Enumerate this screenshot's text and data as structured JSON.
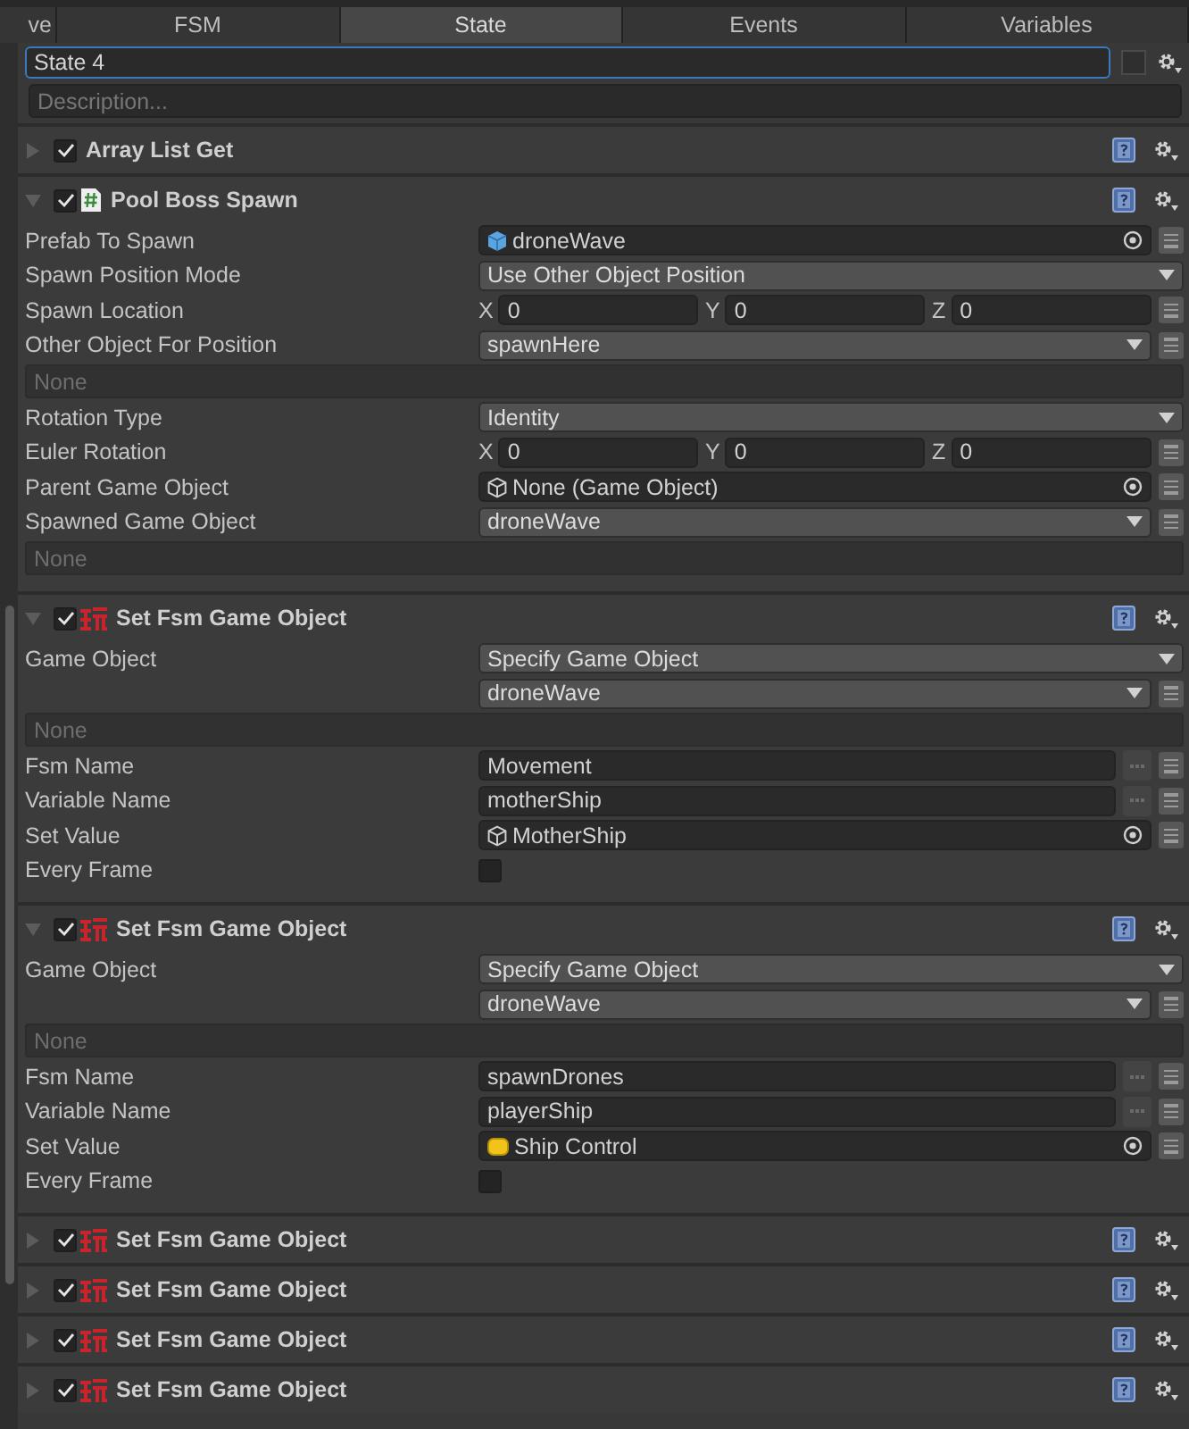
{
  "tabs": [
    {
      "label": "ve",
      "selected": false
    },
    {
      "label": "FSM",
      "selected": false
    },
    {
      "label": "State",
      "selected": true
    },
    {
      "label": "Events",
      "selected": false
    },
    {
      "label": "Variables",
      "selected": false
    }
  ],
  "state": {
    "name": "State 4",
    "description": {
      "placeholder": "Description..."
    }
  },
  "actions": [
    {
      "title": "Array List Get",
      "checked": true,
      "expanded": false,
      "kind": "plain"
    },
    {
      "title": "Pool Boss Spawn",
      "checked": true,
      "expanded": true,
      "kind": "script",
      "fields": [
        {
          "kind": "prefab_object",
          "label": "Prefab To Spawn",
          "value": "droneWave"
        },
        {
          "kind": "dropdown",
          "label": "Spawn Position Mode",
          "value": "Use Other Object Position",
          "variable_button": false
        },
        {
          "kind": "vector",
          "label": "Spawn Location",
          "axes": [
            {
              "axis": "X",
              "value": "0"
            },
            {
              "axis": "Y",
              "value": "0"
            },
            {
              "axis": "Z",
              "value": "0"
            }
          ]
        },
        {
          "kind": "dropdown",
          "label": "Other Object For Position",
          "value": "spawnHere",
          "variable_button": true
        },
        {
          "kind": "none",
          "placeholder": "None"
        },
        {
          "kind": "dropdown",
          "label": "Rotation Type",
          "value": "Identity",
          "variable_button": false
        },
        {
          "kind": "vector",
          "label": "Euler Rotation",
          "axes": [
            {
              "axis": "X",
              "value": "0"
            },
            {
              "axis": "Y",
              "value": "0"
            },
            {
              "axis": "Z",
              "value": "0"
            }
          ]
        },
        {
          "kind": "gameobject_object",
          "label": "Parent Game Object",
          "value": "None (Game Object)"
        },
        {
          "kind": "dropdown",
          "label": "Spawned Game Object",
          "value": "droneWave",
          "variable_button": true
        },
        {
          "kind": "none",
          "placeholder": "None"
        }
      ]
    },
    {
      "title": "Set Fsm Game Object",
      "checked": true,
      "expanded": true,
      "kind": "playmaker",
      "fields": [
        {
          "kind": "dropdown",
          "label": "Game Object",
          "value": "Specify Game Object",
          "variable_button": false
        },
        {
          "kind": "dropdown",
          "value": "droneWave",
          "variable_button": true
        },
        {
          "kind": "none",
          "placeholder": "None"
        },
        {
          "kind": "text",
          "label": "Fsm Name",
          "value": "Movement"
        },
        {
          "kind": "text",
          "label": "Variable Name",
          "value": "motherShip"
        },
        {
          "kind": "gameobject_object",
          "label": "Set Value",
          "value": "MotherShip"
        },
        {
          "kind": "checkbox",
          "label": "Every Frame",
          "checked": false
        }
      ]
    },
    {
      "title": "Set Fsm Game Object",
      "checked": true,
      "expanded": true,
      "kind": "playmaker",
      "fields": [
        {
          "kind": "dropdown",
          "label": "Game Object",
          "value": "Specify Game Object",
          "variable_button": false
        },
        {
          "kind": "dropdown",
          "value": "droneWave",
          "variable_button": true
        },
        {
          "kind": "none",
          "placeholder": "None"
        },
        {
          "kind": "text",
          "label": "Fsm Name",
          "value": "spawnDrones"
        },
        {
          "kind": "text",
          "label": "Variable Name",
          "value": "playerShip"
        },
        {
          "kind": "component_object",
          "label": "Set Value",
          "value": "Ship Control"
        },
        {
          "kind": "checkbox",
          "label": "Every Frame",
          "checked": false
        }
      ]
    },
    {
      "title": "Set Fsm Game Object",
      "checked": true,
      "expanded": false,
      "kind": "playmaker"
    },
    {
      "title": "Set Fsm Game Object",
      "checked": true,
      "expanded": false,
      "kind": "playmaker"
    },
    {
      "title": "Set Fsm Game Object",
      "checked": true,
      "expanded": false,
      "kind": "playmaker"
    },
    {
      "title": "Set Fsm Game Object",
      "checked": true,
      "expanded": false,
      "kind": "playmaker"
    }
  ]
}
